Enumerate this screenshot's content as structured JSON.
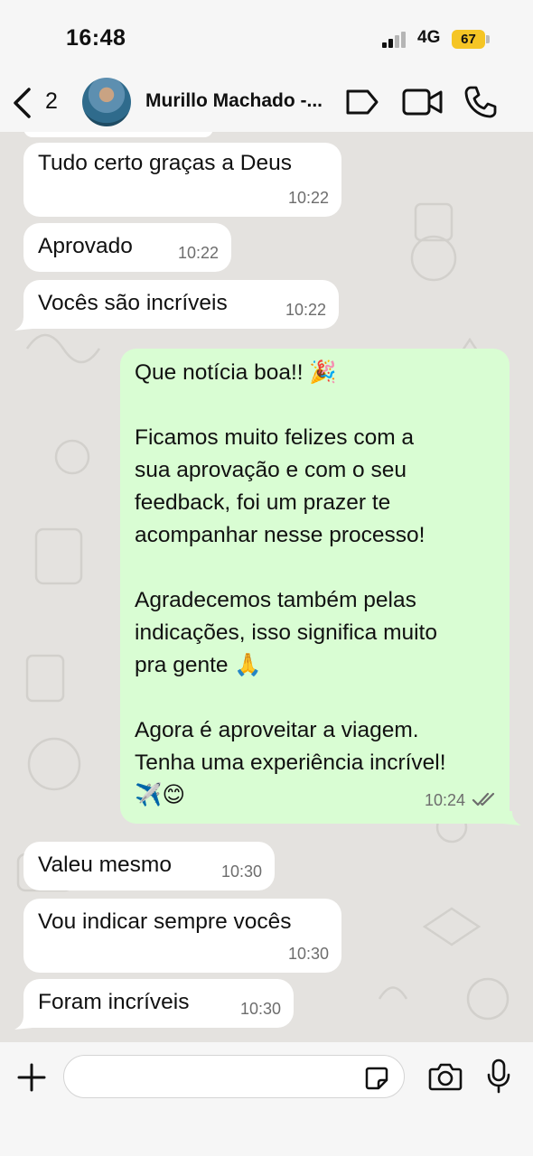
{
  "status_bar": {
    "time": "16:48",
    "network": "4G",
    "battery": "67",
    "battery_color": "#f5c525"
  },
  "header": {
    "back_count": "2",
    "contact_name": "Murillo Machado -...",
    "icons": [
      "back-chevron-icon",
      "label-tag-icon",
      "video-call-icon",
      "phone-icon"
    ]
  },
  "messages": [
    {
      "direction": "in",
      "text": "Tudo certo graças a Deus",
      "time": "10:22"
    },
    {
      "direction": "in",
      "text": "Aprovado",
      "time": "10:22"
    },
    {
      "direction": "in",
      "text": "Vocês são incríveis",
      "time": "10:22"
    },
    {
      "direction": "out",
      "text": "Que notícia boa!! 🎉\n\nFicamos muito felizes com a\nsua aprovação e com o seu\nfeedback, foi um prazer te\nacompanhar nesse processo!\n\nAgradecemos também pelas\nindicações, isso significa muito\npra gente 🙏\n\nAgora é aproveitar a viagem.\nTenha uma experiência incrível!\n✈️😊",
      "time": "10:24",
      "status": "read"
    },
    {
      "direction": "in",
      "text": "Valeu mesmo",
      "time": "10:30"
    },
    {
      "direction": "in",
      "text": "Vou indicar sempre vocês",
      "time": "10:30"
    },
    {
      "direction": "in",
      "text": "Foram incríveis",
      "time": "10:30"
    }
  ],
  "composer": {
    "placeholder": "",
    "icons": [
      "plus-icon",
      "sticker-icon",
      "camera-icon",
      "microphone-icon"
    ]
  },
  "colors": {
    "incoming_bubble": "#ffffff",
    "outgoing_bubble": "#d9fdd3",
    "chat_background": "#e4e2df",
    "read_ticks": "#6d6d6d"
  }
}
